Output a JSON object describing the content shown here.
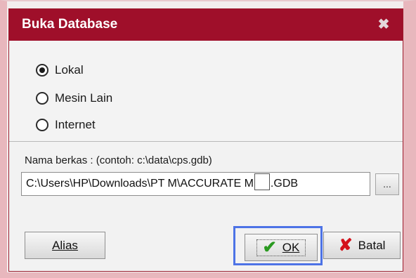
{
  "dialog": {
    "title": "Buka Database",
    "close_symbol": "✖"
  },
  "radio_options": [
    {
      "label": "Lokal",
      "checked": true
    },
    {
      "label": "Mesin Lain",
      "checked": false
    },
    {
      "label": "Internet",
      "checked": false
    }
  ],
  "file": {
    "label": "Nama berkas :  (contoh: c:\\data\\cps.gdb)",
    "path_prefix": "C:\\Users\\HP\\Downloads\\PT M\\ACCURATE M",
    "path_suffix": ".GDB",
    "browse_label": "..."
  },
  "buttons": {
    "alias": "Alias",
    "ok": "OK",
    "batal": "Batal"
  },
  "colors": {
    "titlebar": "#9f0f2a",
    "focus_ring": "#4d73e6",
    "ok_icon": "#2a9a20",
    "cancel_icon": "#d4121b"
  },
  "icons": {
    "ok": "check-icon",
    "cancel": "x-icon",
    "close": "close-icon"
  }
}
